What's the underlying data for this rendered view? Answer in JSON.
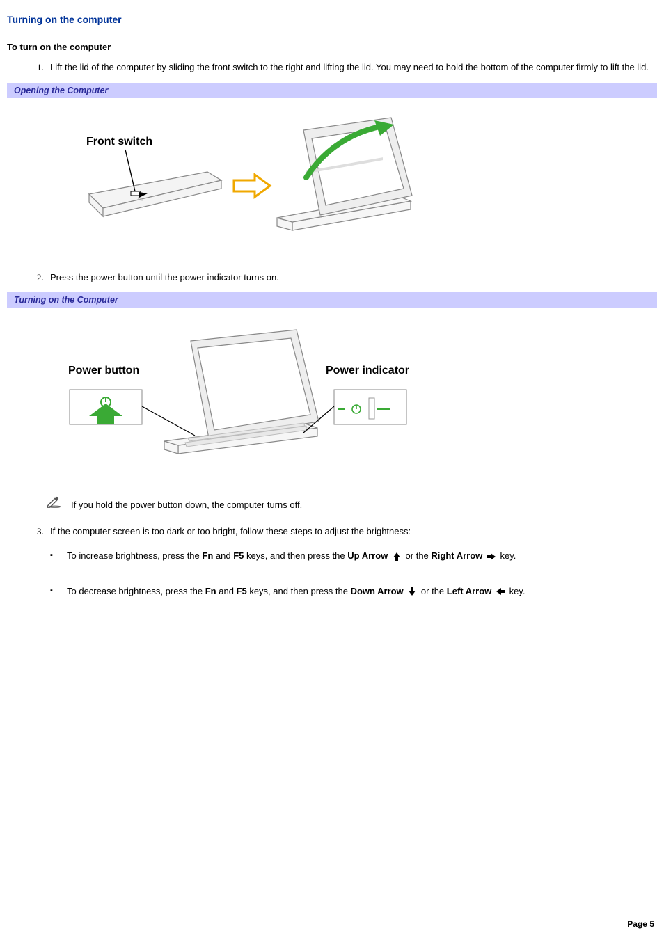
{
  "title": "Turning on the computer",
  "subheading": "To turn on the computer",
  "steps": {
    "one": "Lift the lid of the computer by sliding the front switch to the right and lifting the lid. You may need to hold the bottom of the computer firmly to lift the lid.",
    "two": "Press the power button until the power indicator turns on.",
    "three": "If the computer screen is too dark or too bright, follow these steps to adjust the brightness:"
  },
  "captions": {
    "opening": "Opening the Computer",
    "turning_on": "Turning on the Computer"
  },
  "fig1": {
    "front_switch": "Front switch"
  },
  "fig2": {
    "power_button": "Power button",
    "power_indicator": "Power indicator"
  },
  "note": "If you hold the power button down, the computer turns off.",
  "bullets": {
    "increase": {
      "pre": "To increase brightness, press the ",
      "fn": "Fn",
      "and": " and ",
      "f5": "F5",
      "mid": " keys, and then press the ",
      "up": "Up Arrow",
      "or": " or the ",
      "right": "Right Arrow",
      "post": " key."
    },
    "decrease": {
      "pre": "To decrease brightness, press the ",
      "fn": "Fn",
      "and": " and ",
      "f5": "F5",
      "mid": " keys, and then press the ",
      "down": "Down Arrow",
      "or": " or the ",
      "left": "Left Arrow",
      "post": " key."
    }
  },
  "page": "Page 5"
}
